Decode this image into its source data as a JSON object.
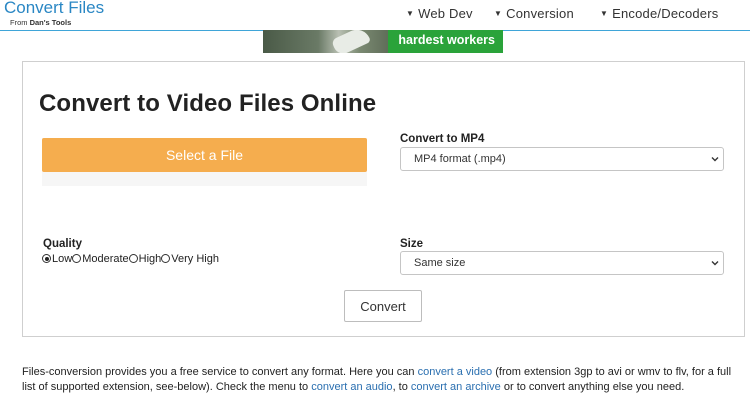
{
  "header": {
    "logo_title": "Convert Files",
    "logo_sub_prefix": "From ",
    "logo_sub_brand": "Dan's Tools",
    "nav": [
      {
        "label": "Web Dev"
      },
      {
        "label": "Conversion"
      },
      {
        "label": "Encode/Decoders"
      }
    ]
  },
  "ad": {
    "text": "hardest workers"
  },
  "main": {
    "title": "Convert to Video Files Online",
    "select_file_label": "Select a File",
    "convert_to_label": "Convert to MP4",
    "format_selected": "MP4 format (.mp4)",
    "quality_label": "Quality",
    "quality_options": [
      {
        "label": "Low",
        "checked": true
      },
      {
        "label": "Moderate",
        "checked": false
      },
      {
        "label": "High",
        "checked": false
      },
      {
        "label": "Very High",
        "checked": false
      }
    ],
    "size_label": "Size",
    "size_selected": "Same size",
    "convert_button": "Convert"
  },
  "description": {
    "part1": "Files-conversion provides you a free service to convert any format. Here you can ",
    "link1": "convert a video",
    "part2": " (from extension 3gp to avi or wmv to flv, for a full list of supported extension, see-below). Check the menu to ",
    "link2": "convert an audio",
    "part3": ", to ",
    "link3": "convert an archive",
    "part4": " or to convert anything else you need."
  },
  "colors": {
    "accent": "#2a87c4",
    "select_button": "#f5ad4e",
    "ad_green": "#2aa33a",
    "link": "#2a6fb0"
  }
}
